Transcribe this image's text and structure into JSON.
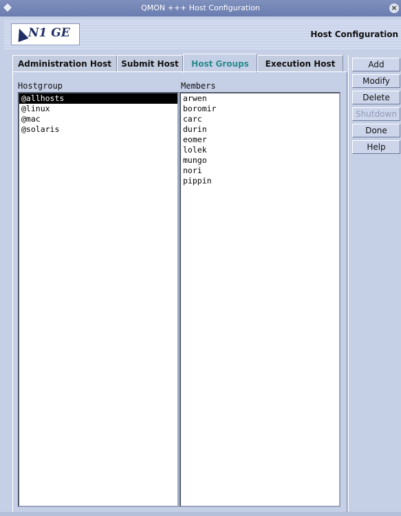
{
  "window": {
    "title": "QMON +++ Host Configuration"
  },
  "header": {
    "logo_text": "N1 GE",
    "title": "Host Configuration"
  },
  "tabs": [
    {
      "label": "Administration Host"
    },
    {
      "label": "Submit Host"
    },
    {
      "label": "Host Groups",
      "active": true
    },
    {
      "label": "Execution Host"
    }
  ],
  "hostgroup": {
    "label": "Hostgroup",
    "items": [
      "@allhosts",
      "@linux",
      "@mac",
      "@solaris"
    ],
    "selected": "@allhosts"
  },
  "members": {
    "label": "Members",
    "items": [
      "arwen",
      "boromir",
      "carc",
      "durin",
      "eomer",
      "lolek",
      "mungo",
      "nori",
      "pippin"
    ]
  },
  "buttons": {
    "add": "Add",
    "modify": "Modify",
    "delete": "Delete",
    "shutdown": "Shutdown",
    "done": "Done",
    "help": "Help"
  },
  "colors": {
    "background": "#c5cfe6",
    "active_tab_text": "#2a8a8a",
    "titlebar": "#6b7db0"
  },
  "icons": {
    "window_menu": "diamond-icon",
    "close": "close-icon",
    "logo": "star-logo-icon"
  }
}
